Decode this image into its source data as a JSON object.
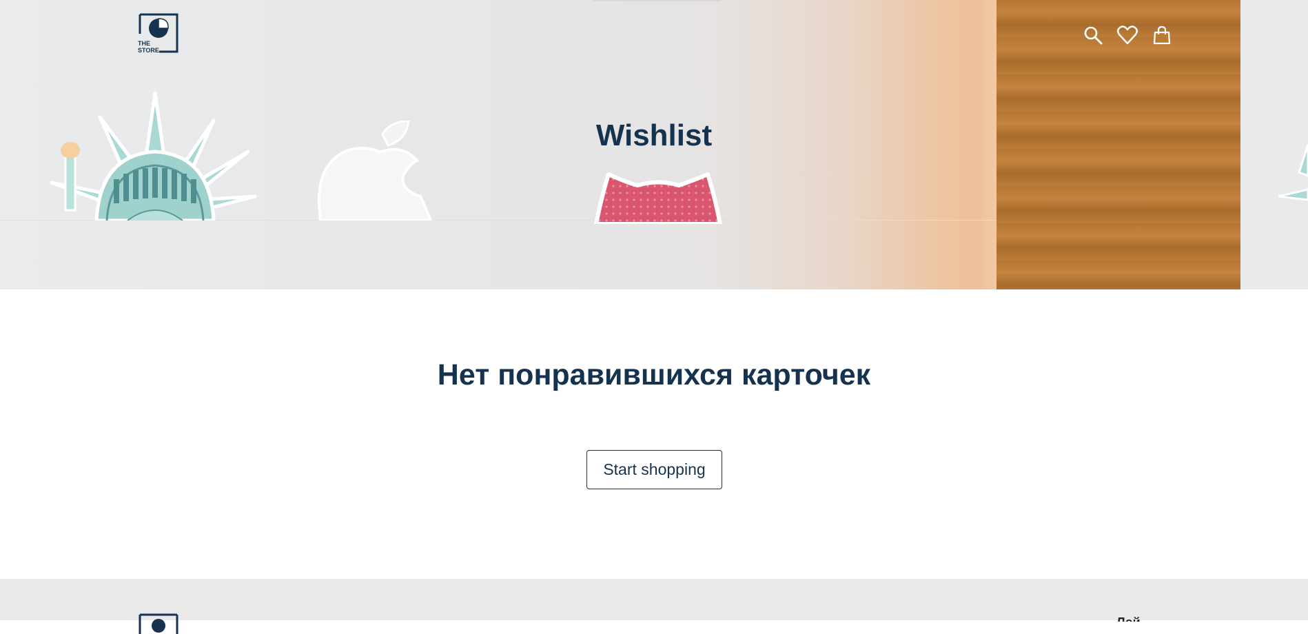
{
  "brand": {
    "logo_text_line1": "THE",
    "logo_text_line2": "STORE",
    "logo_icon": "sticker-moon-icon"
  },
  "header": {
    "icons": [
      {
        "name": "search-icon",
        "label": "Search"
      },
      {
        "name": "heart-icon",
        "label": "Wishlist"
      },
      {
        "name": "shopping-bag-icon",
        "label": "Cart"
      }
    ]
  },
  "hero": {
    "title": "Wishlist"
  },
  "main": {
    "empty_message": "Нет понравившихся карточек",
    "start_shopping_label": "Start shopping"
  },
  "footer": {
    "link_partial": "Лой"
  },
  "colors": {
    "primary": "#15324f",
    "footer_bg": "#e9e9e9",
    "hero_wood": "#b67733"
  }
}
